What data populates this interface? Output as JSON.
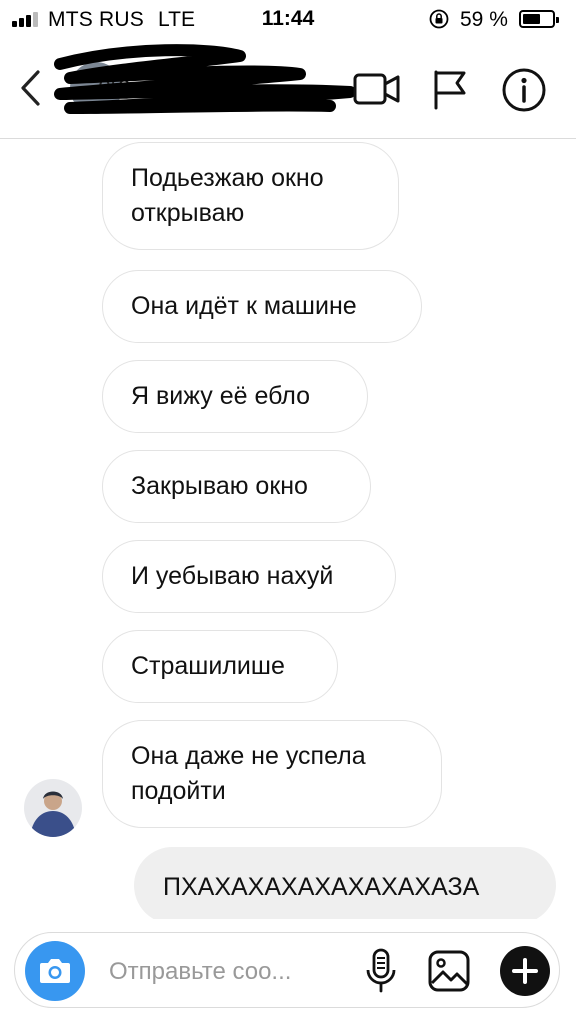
{
  "status_bar": {
    "carrier": "MTS RUS",
    "network": "LTE",
    "time": "11:44",
    "battery_percent": "59 %",
    "battery_level": 0.59,
    "signal_bars": 3,
    "icons": [
      "signal-icon",
      "orientation-lock-icon",
      "battery-icon"
    ]
  },
  "header": {
    "username": "...ого",
    "username_redacted": true,
    "icons": [
      "chevron-left-icon",
      "video-camera-icon",
      "flag-icon",
      "info-icon"
    ]
  },
  "messages": [
    {
      "sender": "other",
      "text": "Подьезжаю окно открываю"
    },
    {
      "sender": "other",
      "text": "Она идёт к машине"
    },
    {
      "sender": "other",
      "text": "Я вижу её ебло"
    },
    {
      "sender": "other",
      "text": "Закрываю окно"
    },
    {
      "sender": "other",
      "text": "И уебываю нахуй"
    },
    {
      "sender": "other",
      "text": "Страшилише"
    },
    {
      "sender": "other",
      "text": "Она даже не успела подойти"
    },
    {
      "sender": "me",
      "text": "ПХАХАХАХАХАХАХАХАЗА"
    }
  ],
  "composer": {
    "placeholder": "Отправьте соо...",
    "icons": [
      "camera-icon",
      "microphone-icon",
      "gallery-icon",
      "plus-icon"
    ]
  },
  "colors": {
    "accent": "#3897f0",
    "own_bubble": "#efefef",
    "bubble_border": "#e3e3e3",
    "divider": "#dbdbdb"
  }
}
